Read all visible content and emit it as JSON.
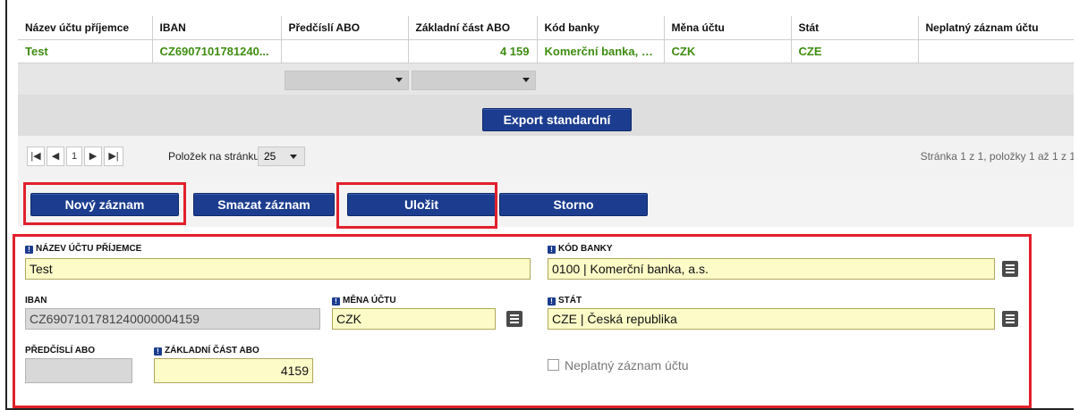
{
  "table": {
    "headers": [
      "Název účtu příjemce",
      "IBAN",
      "Předčíslí ABO",
      "Základní část ABO",
      "Kód banky",
      "Měna účtu",
      "Stát",
      "Neplatný záznam účtu"
    ],
    "row": [
      "Test",
      "CZ6907101781240...",
      "",
      "4 159",
      "Komerční banka, a.s.",
      "CZK",
      "CZE",
      ""
    ]
  },
  "toolbar": {
    "export_label": "Export standardní"
  },
  "pager": {
    "first": "|◀",
    "prev": "◀",
    "page": "1",
    "next": "▶",
    "last": "▶|",
    "per_page_label": "Položek na stránku",
    "per_page_value": "25",
    "info": "Stránka 1 z 1, položky 1 až 1 z 1"
  },
  "actions": {
    "new_label": "Nový záznam",
    "delete_label": "Smazat záznam",
    "save_label": "Uložit",
    "cancel_label": "Storno"
  },
  "form": {
    "recipient_name": {
      "label": "NÁZEV ÚČTU PŘÍJEMCE",
      "value": "Test"
    },
    "bank_code": {
      "label": "KÓD BANKY",
      "value": "0100 | Komerční banka, a.s."
    },
    "iban": {
      "label": "IBAN",
      "value": "CZ6907101781240000004159"
    },
    "currency": {
      "label": "MĚNA ÚČTU",
      "value": "CZK"
    },
    "state": {
      "label": "STÁT",
      "value": "CZE | Česká republika"
    },
    "prefix_abo": {
      "label": "PŘEDČÍSLÍ ABO",
      "value": ""
    },
    "base_abo": {
      "label": "ZÁKLADNÍ ČÁST ABO",
      "value": "4159"
    },
    "invalid_checkbox": {
      "label": "Neplatný záznam účtu"
    }
  },
  "colors": {
    "accent": "#1c3d8f",
    "highlight": "#e2202b",
    "link_green": "#3f8d12",
    "required_bg": "#fdfbc7"
  },
  "icons": {
    "required": "exclamation-badge-icon",
    "lookup": "list-icon"
  }
}
